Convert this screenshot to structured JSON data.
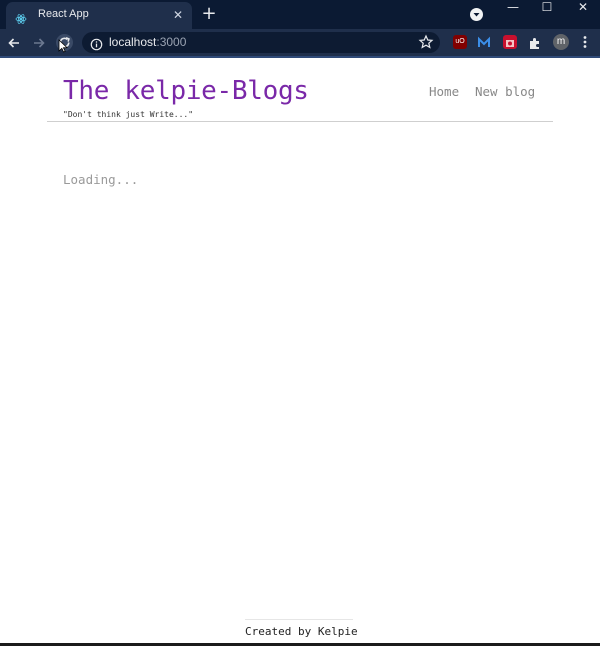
{
  "browser": {
    "tab": {
      "title": "React App",
      "favicon": "react-atom-icon"
    },
    "address": {
      "host": "localhost",
      "port": ":3000"
    },
    "extension_labels": {
      "ublock": "uO",
      "avatar": "m"
    },
    "colors": {
      "titlebar": "#0b1a33",
      "toolbar": "#1f2f4b",
      "omnibox": "#0d1b32"
    }
  },
  "page": {
    "brand": "The kelpie-Blogs",
    "tagline": "\"Don't think just Write...\"",
    "nav": {
      "home": "Home",
      "new_blog": "New blog"
    },
    "status": "Loading...",
    "footer": "Created by Kelpie",
    "colors": {
      "brand": "#7a28a8",
      "nav": "#888888",
      "status": "#9a9a9a"
    }
  }
}
